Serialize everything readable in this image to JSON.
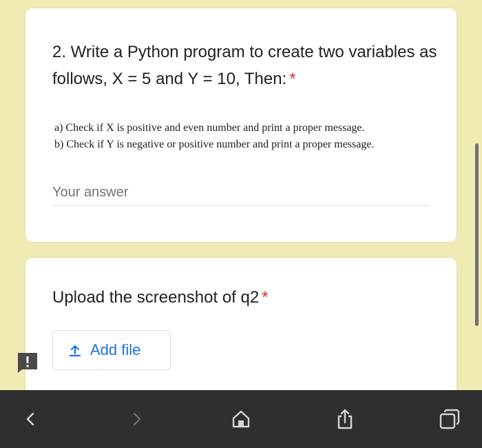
{
  "form": {
    "question2": {
      "title": "2. Write a Python program to create two variables as follows, X = 5 and Y = 10, Then:",
      "required_marker": "*",
      "description": [
        "a) Check if X is positive and even number and print a proper message.",
        "b) Check if Y is negative or positive number and print a proper message."
      ],
      "answer_placeholder": "Your answer",
      "answer_value": ""
    },
    "upload": {
      "title": "Upload the screenshot of q2",
      "required_marker": "*",
      "button_label": "Add file",
      "button_icon": "upload-icon"
    }
  },
  "browser_toolbar": {
    "icons": [
      "back-icon",
      "forward-icon",
      "home-icon",
      "share-icon",
      "tabs-icon"
    ]
  },
  "colors": {
    "page_background": "#f0ebb2",
    "card_background": "#ffffff",
    "required": "#d93025",
    "accent": "#1a73e8",
    "toolbar_background": "#2f2f2f"
  }
}
